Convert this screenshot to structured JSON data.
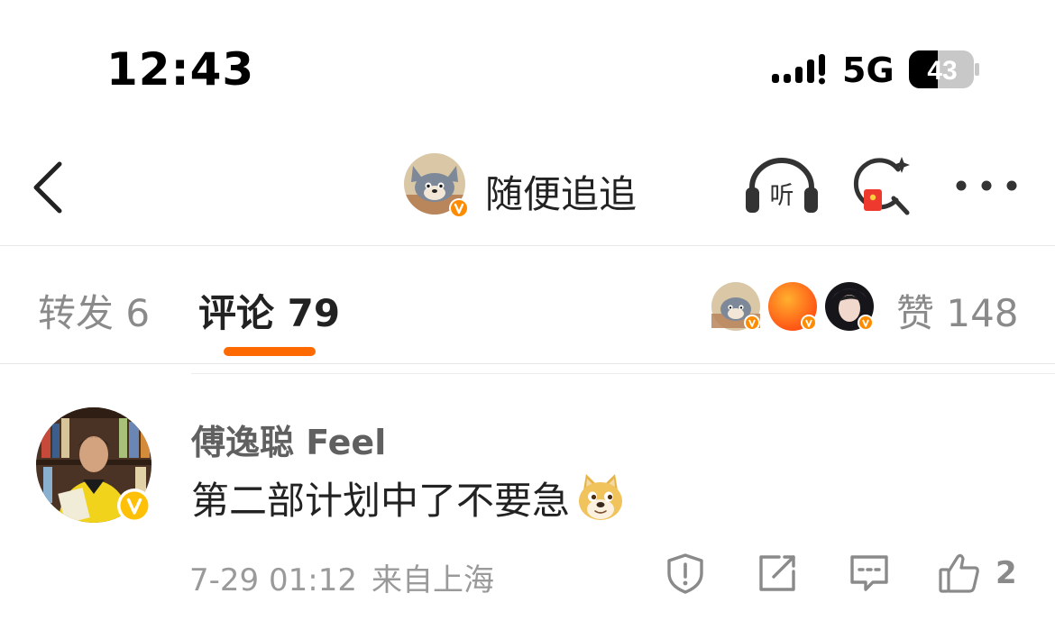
{
  "status_bar": {
    "time": "12:43",
    "network": "5G",
    "battery": "43"
  },
  "nav": {
    "title": "随便追追",
    "back_icon": "chevron-left-icon",
    "listen_label": "听",
    "search_icon": "ai-search-icon",
    "more_icon": "ellipsis-icon"
  },
  "tabs": {
    "repost": "转发 6",
    "comments": "评论 79",
    "likes": "赞 148"
  },
  "colors": {
    "accent": "#ff6a00",
    "verified_badge": "#ff8c00",
    "vip_badge": "#ffc107"
  },
  "comment": {
    "author": "傅逸聪 Feel",
    "text": "第二部计划中了不要急",
    "emoji": "doge-icon",
    "date": "7-29 01:12",
    "location": "来自上海",
    "like_count": "2"
  }
}
